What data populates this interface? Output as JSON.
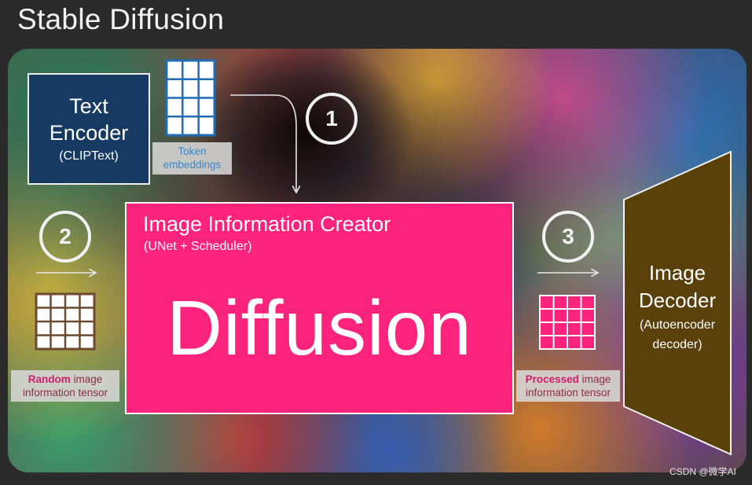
{
  "title": "Stable Diffusion",
  "text_encoder": {
    "line1": "Text",
    "line2": "Encoder",
    "line3": "(CLIPText)"
  },
  "token_embeddings": {
    "line1": "Token",
    "line2": "embeddings"
  },
  "steps": [
    "1",
    "2",
    "3"
  ],
  "image_information_creator": {
    "title": "Image Information Creator",
    "subtitle": "(UNet + Scheduler)",
    "main_label": "Diffusion"
  },
  "random_tensor": {
    "bold": "Random",
    "rest1": " image",
    "line2": "information tensor"
  },
  "processed_tensor": {
    "bold": "Processed",
    "rest1": " image",
    "line2": "information tensor"
  },
  "image_decoder": {
    "line1": "Image",
    "line2": "Decoder",
    "line3": "(Autoencoder",
    "line4": "decoder)"
  },
  "watermark": "CSDN @微学AI",
  "colors": {
    "text_encoder_bg": "#173a63",
    "creator_bg": "#fb237b",
    "decoder_bg": "#5a400a",
    "token_grid": "#1f6db3",
    "random_grid": "#6b4a2e",
    "processed_grid": "#fb237b"
  }
}
